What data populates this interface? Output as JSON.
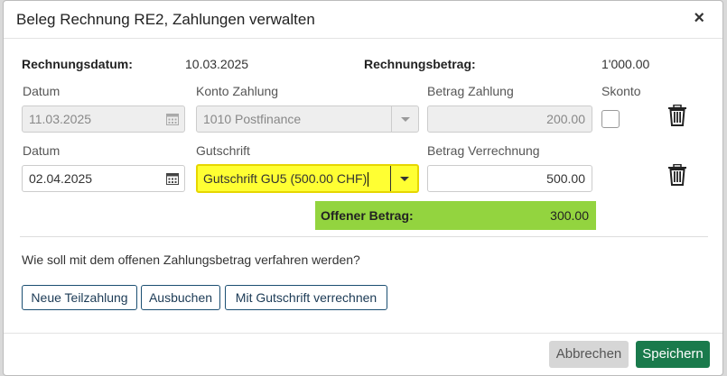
{
  "dialog": {
    "title": "Beleg Rechnung RE2, Zahlungen verwalten",
    "close_symbol": "×"
  },
  "summary": {
    "date_label": "Rechnungsdatum:",
    "date_value": "10.03.2025",
    "amount_label": "Rechnungsbetrag:",
    "amount_value": "1'000.00"
  },
  "payment_row": {
    "date_label": "Datum",
    "date_value": "11.03.2025",
    "account_label": "Konto Zahlung",
    "account_value": "1010 Postfinance",
    "amount_label": "Betrag Zahlung",
    "amount_value": "200.00",
    "discount_label": "Skonto",
    "discount_checked": false
  },
  "credit_row": {
    "date_label": "Datum",
    "date_value": "02.04.2025",
    "credit_label": "Gutschrift",
    "credit_value": "Gutschrift GU5 (500.00 CHF)",
    "amount_label": "Betrag Verrechnung",
    "amount_value": "500.00"
  },
  "open_amount": {
    "label": "Offener Betrag:",
    "value": "300.00",
    "color": "#93d43f"
  },
  "question": "Wie soll mit dem offenen Zahlungsbetrag verfahren werden?",
  "actions": {
    "new_partial": "Neue Teilzahlung",
    "book_out": "Ausbuchen",
    "settle_credit": "Mit Gutschrift verrechnen"
  },
  "footer": {
    "cancel": "Abbrechen",
    "save": "Speichern",
    "save_color": "#1a7a4c"
  },
  "icons": {
    "calendar": "calendar-icon",
    "trash": "trash-icon",
    "dropdown": "chevron-down-icon"
  }
}
